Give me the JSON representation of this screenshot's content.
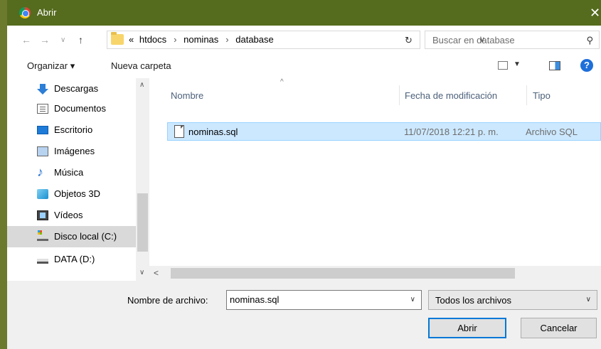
{
  "window": {
    "title": "Abrir",
    "close_glyph": "✕"
  },
  "address": {
    "overflow": "«",
    "crumbs": [
      "htdocs",
      "nominas",
      "database"
    ],
    "search_placeholder": "Buscar en database"
  },
  "toolbar": {
    "organize": "Organizar ▾",
    "new_folder": "Nueva carpeta",
    "help": "?"
  },
  "sidebar": {
    "items": [
      {
        "label": "Descargas",
        "icon": "download-icon"
      },
      {
        "label": "Documentos",
        "icon": "documents-icon"
      },
      {
        "label": "Escritorio",
        "icon": "desktop-icon"
      },
      {
        "label": "Imágenes",
        "icon": "images-icon"
      },
      {
        "label": "Música",
        "icon": "music-icon"
      },
      {
        "label": "Objetos 3D",
        "icon": "3d-objects-icon"
      },
      {
        "label": "Vídeos",
        "icon": "videos-icon"
      },
      {
        "label": "Disco local (C:)",
        "icon": "local-disk-icon",
        "selected": true
      },
      {
        "label": "DATA (D:)",
        "icon": "drive-icon"
      }
    ]
  },
  "filelist": {
    "columns": [
      "Nombre",
      "Fecha de modificación",
      "Tipo"
    ],
    "rows": [
      {
        "name": "nominas.sql",
        "modified": "11/07/2018 12:21 p. m.",
        "type": "Archivo SQL"
      }
    ]
  },
  "footer": {
    "filename_label": "Nombre de archivo:",
    "filename_value": "nominas.sql",
    "filter_value": "Todos los archivos",
    "open_label": "Abrir",
    "cancel_label": "Cancelar"
  }
}
